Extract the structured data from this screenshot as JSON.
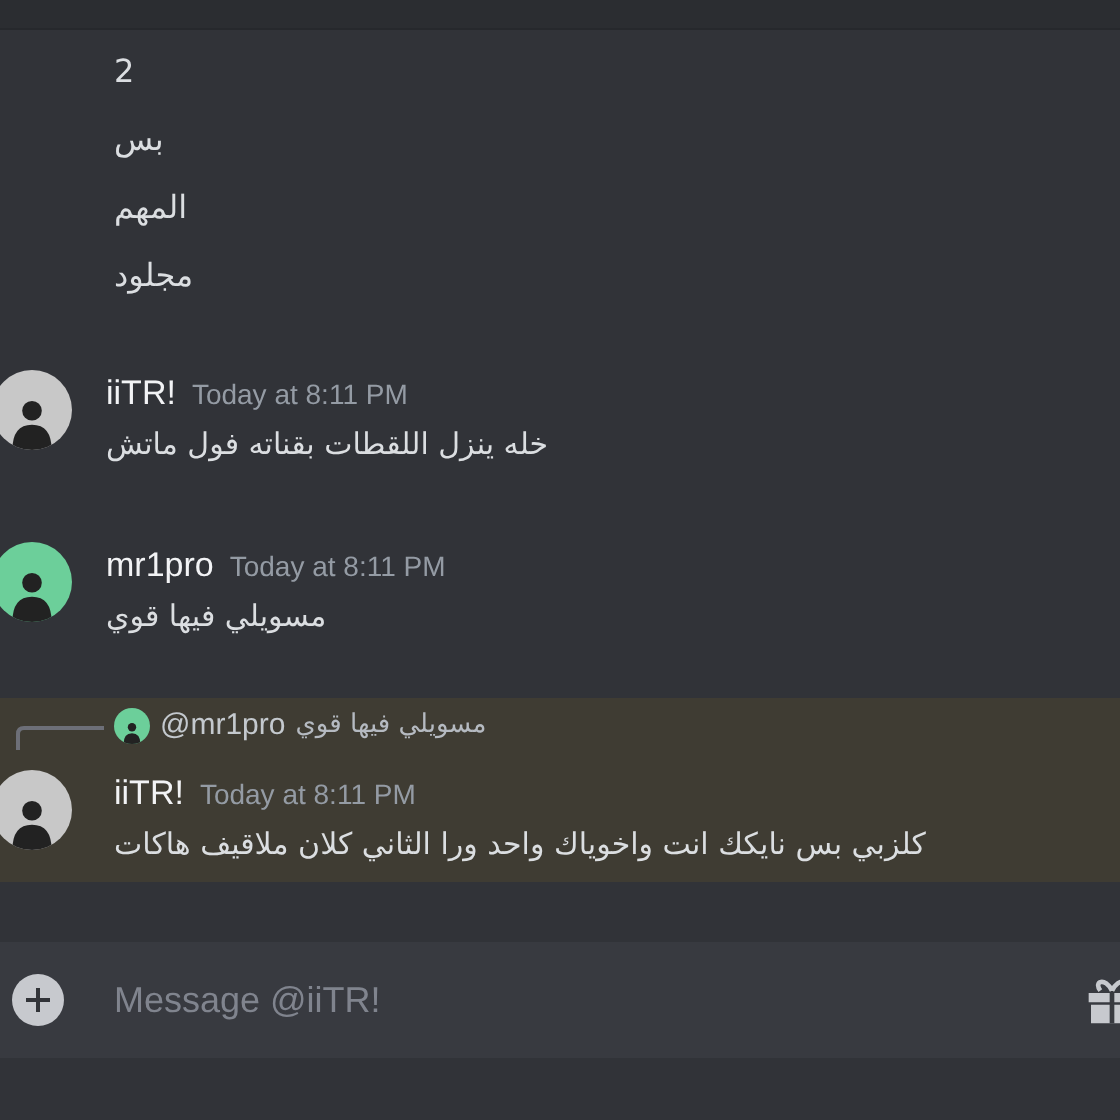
{
  "messages": [
    {
      "kind": "continuation",
      "text": "2"
    },
    {
      "kind": "continuation",
      "text": "بس"
    },
    {
      "kind": "continuation",
      "text": "المهم"
    },
    {
      "kind": "continuation",
      "text": "مجلود"
    },
    {
      "kind": "message",
      "author": "iiTR!",
      "color": "#c8c8c8",
      "time": "Today at 8:11 PM",
      "text": "خله ينزل اللقطات بقناته فول ماتش"
    },
    {
      "kind": "message",
      "author": "mr1pro",
      "color": "#6ccf9a",
      "time": "Today at 8:11 PM",
      "text": "مسويلي فيها قوي"
    },
    {
      "kind": "reply",
      "reply_to": {
        "author": "@mr1pro",
        "color": "#6ccf9a",
        "text": "مسويلي فيها قوي"
      },
      "author": "iiTR!",
      "color": "#c8c8c8",
      "time": "Today at 8:11 PM",
      "text": "كلزبي بس نايكك انت واخوياك واحد ورا الثاني كلان ملاقيف هاكات",
      "mentioned": true
    }
  ],
  "composer": {
    "placeholder": "Message @iiTR!"
  }
}
